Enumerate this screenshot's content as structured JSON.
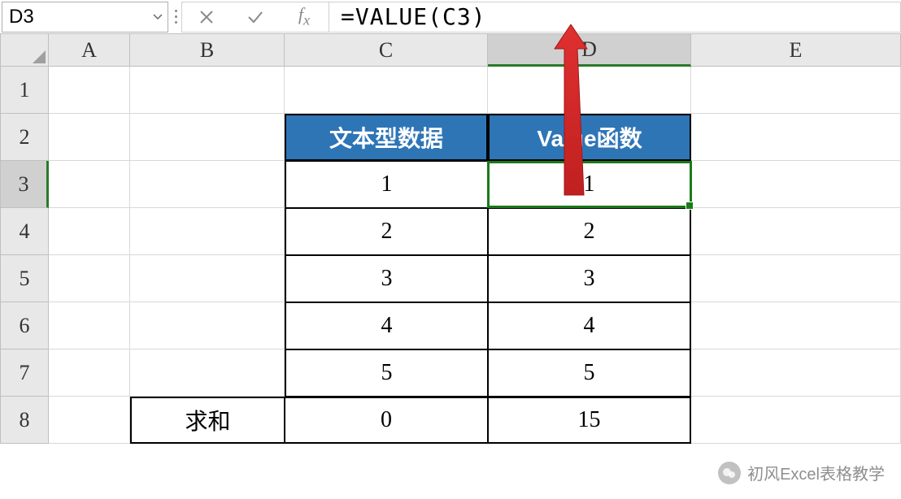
{
  "name_box": {
    "value": "D3"
  },
  "formula_bar": {
    "value": "=VALUE(C3)"
  },
  "columns": [
    "A",
    "B",
    "C",
    "D",
    "E"
  ],
  "rows": [
    "1",
    "2",
    "3",
    "4",
    "5",
    "6",
    "7",
    "8"
  ],
  "active_col": "D",
  "active_row": "3",
  "table": {
    "headers": {
      "c": "文本型数据",
      "d": "Value函数"
    },
    "sum_label": "求和",
    "data": {
      "r3": {
        "c": "1",
        "d": "1"
      },
      "r4": {
        "c": "2",
        "d": "2"
      },
      "r5": {
        "c": "3",
        "d": "3"
      },
      "r6": {
        "c": "4",
        "d": "4"
      },
      "r7": {
        "c": "5",
        "d": "5"
      },
      "r8": {
        "c": "0",
        "d": "15"
      }
    }
  },
  "watermark": {
    "text": "初风Excel表格教学"
  }
}
